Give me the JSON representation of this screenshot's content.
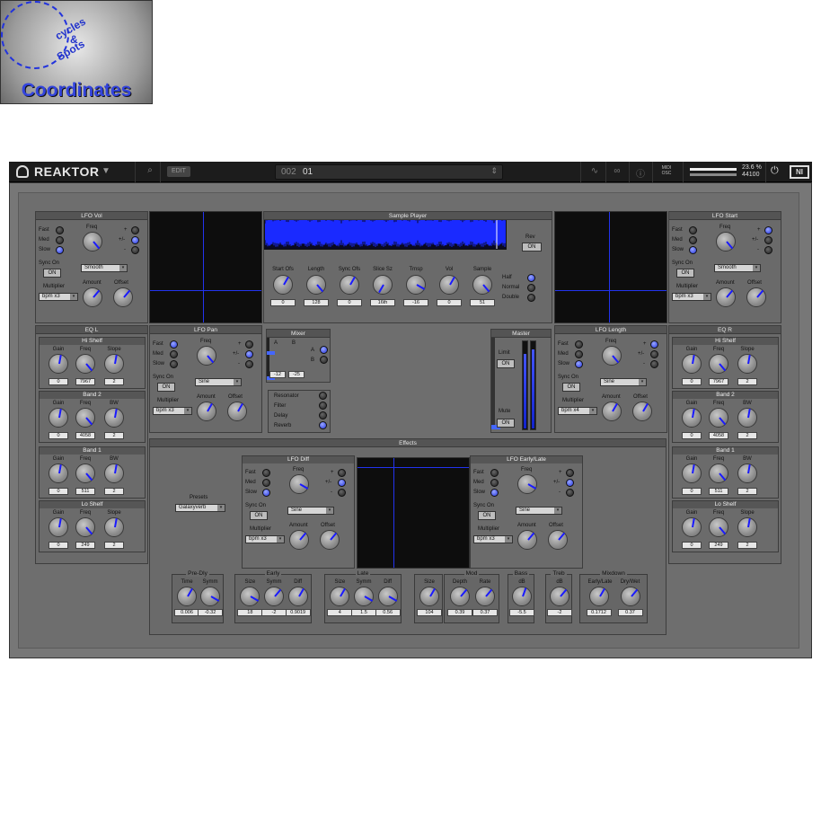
{
  "topbar": {
    "app_title": "REAKTOR",
    "menu_arrow": "▼",
    "search_icon": "⌕",
    "edit_label": "EDIT",
    "preset_number": "002",
    "preset_name": "01",
    "preset_arrows": "⇕",
    "icons": [
      "wave-icon",
      "tape-icon",
      "info-icon"
    ],
    "midi_label": "MIDI",
    "osc_label": "OSC",
    "cpu": "23.6 %",
    "sample_rate": "44100",
    "power_icon": "⏻",
    "ni_logo": "NI"
  },
  "lfo_vol": {
    "title": "LFO Vol",
    "fast": "Fast",
    "med": "Med",
    "slow": "Slow",
    "freq": "Freq",
    "plus": "+",
    "plusminus": "+/-",
    "minus": "-",
    "sync": "Sync On",
    "sync_btn": "ON",
    "shape": "Smooth",
    "amount": "Amount",
    "offset": "Offset",
    "multiplier": "Multiplier",
    "mult_val": "bpm x3"
  },
  "lfo_start": {
    "title": "LFO Start",
    "fast": "Fast",
    "med": "Med",
    "slow": "Slow",
    "freq": "Freq",
    "plus": "+",
    "plusminus": "+/-",
    "minus": "-",
    "sync": "Sync On",
    "sync_btn": "ON",
    "shape": "Smooth",
    "amount": "Amount",
    "offset": "Offset",
    "multiplier": "Multiplier",
    "mult_val": "bpm x3"
  },
  "sample_player": {
    "title": "Sample Player",
    "rev": "Rev",
    "rev_btn": "ON",
    "knobs": [
      {
        "label": "Start Ofs",
        "value": "0"
      },
      {
        "label": "Length",
        "value": "128"
      },
      {
        "label": "Sync Ofs",
        "value": "0"
      },
      {
        "label": "Slice Sz",
        "value": "16th"
      },
      {
        "label": "Trnsp",
        "value": "-16"
      },
      {
        "label": "Vol",
        "value": "0"
      },
      {
        "label": "Sample",
        "value": "51"
      }
    ],
    "half": "Half",
    "normal": "Normal",
    "double": "Double"
  },
  "eq_l": {
    "title": "EQ L",
    "hi": {
      "title": "Hi Shelf",
      "l1": "Gain",
      "l2": "Freq",
      "l3": "Slope",
      "v1": "0",
      "v2": "7967",
      "v3": "2"
    },
    "b2": {
      "title": "Band 2",
      "l1": "Gain",
      "l2": "Freq",
      "l3": "BW",
      "v1": "0",
      "v2": "4058",
      "v3": "2"
    },
    "b1": {
      "title": "Band 1",
      "l1": "Gain",
      "l2": "Freq",
      "l3": "BW",
      "v1": "0",
      "v2": "511",
      "v3": "2"
    },
    "lo": {
      "title": "Lo Shelf",
      "l1": "Gain",
      "l2": "Freq",
      "l3": "Slope",
      "v1": "0",
      "v2": "249",
      "v3": "2"
    }
  },
  "eq_r": {
    "title": "EQ R",
    "hi": {
      "title": "Hi Shelf",
      "l1": "Gain",
      "l2": "Freq",
      "l3": "Slope",
      "v1": "0",
      "v2": "7967",
      "v3": "2"
    },
    "b2": {
      "title": "Band 2",
      "l1": "Gain",
      "l2": "Freq",
      "l3": "BW",
      "v1": "0",
      "v2": "4058",
      "v3": "2"
    },
    "b1": {
      "title": "Band 1",
      "l1": "Gain",
      "l2": "Freq",
      "l3": "BW",
      "v1": "0",
      "v2": "511",
      "v3": "2"
    },
    "lo": {
      "title": "Lo Shelf",
      "l1": "Gain",
      "l2": "Freq",
      "l3": "Slope",
      "v1": "0",
      "v2": "249",
      "v3": "2"
    }
  },
  "lfo_pan": {
    "title": "LFO Pan",
    "fast": "Fast",
    "med": "Med",
    "slow": "Slow",
    "freq": "Freq",
    "plus": "+",
    "plusminus": "+/-",
    "minus": "-",
    "sync": "Sync On",
    "sync_btn": "ON",
    "shape": "Sine",
    "amount": "Amount",
    "offset": "Offset",
    "multiplier": "Multiplier",
    "mult_val": "bpm x3"
  },
  "lfo_length": {
    "title": "LFO Length",
    "fast": "Fast",
    "med": "Med",
    "slow": "Slow",
    "freq": "Freq",
    "plus": "+",
    "plusminus": "+/-",
    "minus": "-",
    "sync": "Sync On",
    "sync_btn": "ON",
    "shape": "Sine",
    "amount": "Amount",
    "offset": "Offset",
    "multiplier": "Multiplier",
    "mult_val": "bpm x4"
  },
  "mixer": {
    "title": "Mixer",
    "a": "A",
    "b": "B",
    "va": "-12",
    "vb": "-25",
    "ra": "A",
    "rb": "B",
    "fx": [
      "Resonator",
      "Filter",
      "Delay",
      "Reverb"
    ]
  },
  "logo": {
    "word1": "cycles",
    "word2": "&",
    "word3": "Spots",
    "name": "Coordinates"
  },
  "master": {
    "title": "Master",
    "limit": "Limit",
    "limit_btn": "ON",
    "mute": "Mute",
    "mute_btn": "ON",
    "level_l": 0.85,
    "level_r": 0.9
  },
  "effects": {
    "title": "Effects",
    "presets": "Presets",
    "preset_val": "Galaxyverb",
    "lfo_diff": {
      "title": "LFO Diff",
      "fast": "Fast",
      "med": "Med",
      "slow": "Slow",
      "freq": "Freq",
      "plus": "+",
      "plusminus": "+/-",
      "minus": "-",
      "sync": "Sync On",
      "sync_btn": "ON",
      "shape": "Sine",
      "amount": "Amount",
      "offset": "Offset",
      "multiplier": "Multiplier",
      "mult_val": "bpm x3"
    },
    "lfo_el": {
      "title": "LFO Early/Late",
      "fast": "Fast",
      "med": "Med",
      "slow": "Slow",
      "freq": "Freq",
      "plus": "+",
      "plusminus": "+/-",
      "minus": "-",
      "sync": "Sync On",
      "sync_btn": "ON",
      "shape": "Sine",
      "amount": "Amount",
      "offset": "Offset",
      "multiplier": "Multiplier",
      "mult_val": "bpm x3"
    },
    "predly": {
      "title": "Pre-Dly",
      "l1": "Time",
      "l2": "Symm",
      "v1": "0.006",
      "v2": "-0.32"
    },
    "early": {
      "title": "Early",
      "l1": "Size",
      "l2": "Symm",
      "l3": "Diff",
      "v1": "18",
      "v2": "-2",
      "v3": "0.9019"
    },
    "late": {
      "title": "Late",
      "l1": "Size",
      "l2": "Symm",
      "l3": "Diff",
      "v1": "4",
      "v2": "1.5",
      "v3": "0.56"
    },
    "size": {
      "l1": "Size",
      "v1": "104"
    },
    "mod": {
      "title": "Mod",
      "l1": "Depth",
      "l2": "Rate",
      "v1": "0.39",
      "v2": "0.37"
    },
    "bass": {
      "title": "Bass",
      "l1": "dB",
      "v1": "-5.5"
    },
    "treb": {
      "title": "Treb",
      "l1": "dB",
      "v1": "-2"
    },
    "mixdown": {
      "title": "Mixdown",
      "l1": "Early/Late",
      "l2": "Dry/Wet",
      "v1": "0.1712",
      "v2": "0.37"
    }
  }
}
